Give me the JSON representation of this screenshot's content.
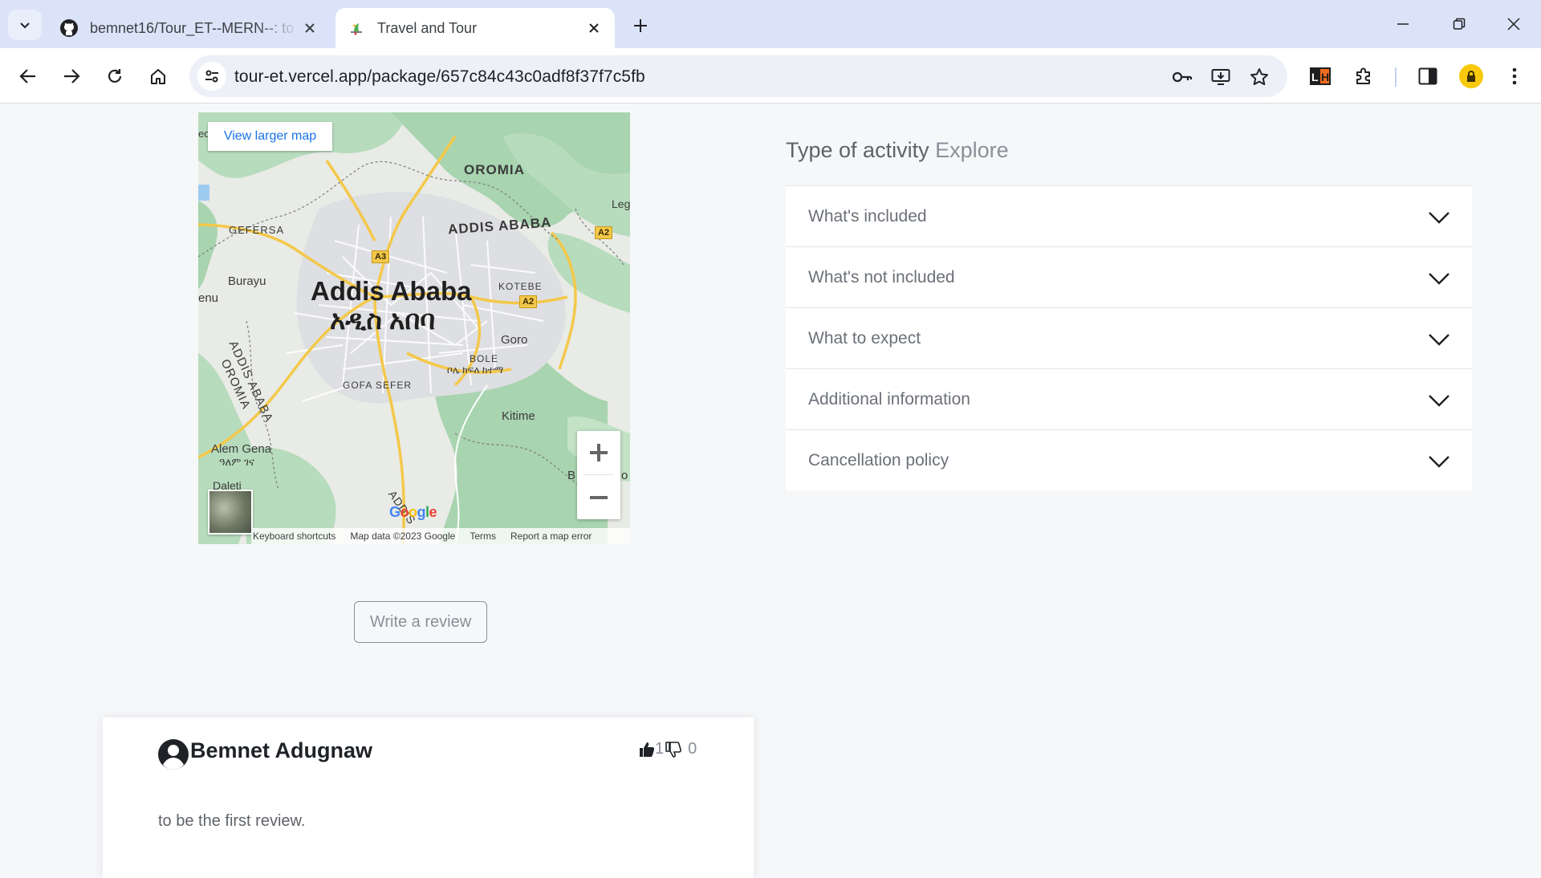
{
  "browser": {
    "tabs": [
      {
        "title": "bemnet16/Tour_ET--MERN--: to",
        "icon": "github-icon",
        "active": false
      },
      {
        "title": "Travel and Tour",
        "icon": "site-favicon",
        "active": true
      }
    ],
    "url": "tour-et.vercel.app/package/657c84c43c0adf8f37f7c5fb"
  },
  "map": {
    "view_larger_label": "View larger map",
    "labels": {
      "city": "Addis Ababa",
      "city_amharic": "አዲስ አበባ",
      "oromia_top": "OROMIA",
      "addis_top": "ADDIS ABABA",
      "gefersa": "GEFERSA",
      "burayu": "Burayu",
      "kotebe": "KOTEBE",
      "goro": "Goro",
      "bole": "BOLE",
      "bole_amharic": "ቦሌ ክፍለ ከተማ",
      "gofa_sefer": "GOFA SEFER",
      "addis_left": "ADDIS ABABA",
      "oromia_left": "OROMIA",
      "kitime": "Kitime",
      "alem_gena": "Alem Gena",
      "alem_gena_amharic": "ዓለም ገና",
      "daleti": "Daleti",
      "leg": "Leg",
      "enu": "enu",
      "ed": "ed",
      "b_label": "B",
      "o_label": "o",
      "a3": "A3",
      "a2_top": "A2",
      "a2_mid": "A2",
      "addis_bottom": "ADDIS"
    },
    "google": "Google",
    "attribution": [
      "Keyboard shortcuts",
      "Map data ©2023 Google",
      "Terms",
      "Report a map error"
    ]
  },
  "review_button_label": "Write a review",
  "activity": {
    "label": "Type of activity",
    "value": "Explore"
  },
  "accordion": [
    {
      "label": "What's included"
    },
    {
      "label": "What's not included"
    },
    {
      "label": "What to expect"
    },
    {
      "label": "Additional information"
    },
    {
      "label": "Cancellation policy"
    }
  ],
  "review": {
    "user": "Bemnet Adugnaw",
    "likes": "1",
    "dislikes": "0",
    "text": "to be the first review."
  }
}
